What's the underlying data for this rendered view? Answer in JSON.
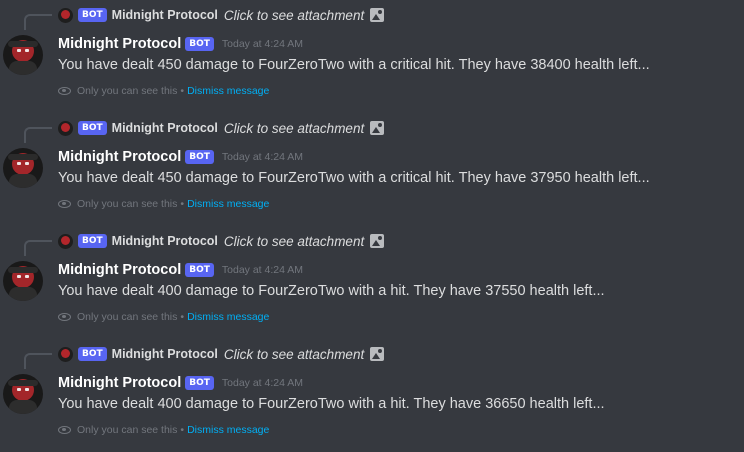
{
  "messages": [
    {
      "reply": {
        "bot_tag": "BOT",
        "name": "Midnight Protocol",
        "text": "Click to see attachment",
        "icon": "image-icon"
      },
      "author": "Midnight Protocol",
      "bot_tag": "BOT",
      "timestamp": "Today at 4:24 AM",
      "content": "You have dealt 450 damage to FourZeroTwo with a critical hit. They have 38400 health left...",
      "ephemeral_note": "Only you can see this",
      "separator": "•",
      "dismiss_label": "Dismiss message"
    },
    {
      "reply": {
        "bot_tag": "BOT",
        "name": "Midnight Protocol",
        "text": "Click to see attachment",
        "icon": "image-icon"
      },
      "author": "Midnight Protocol",
      "bot_tag": "BOT",
      "timestamp": "Today at 4:24 AM",
      "content": "You have dealt 450 damage to FourZeroTwo with a critical hit. They have 37950 health left...",
      "ephemeral_note": "Only you can see this",
      "separator": "•",
      "dismiss_label": "Dismiss message"
    },
    {
      "reply": {
        "bot_tag": "BOT",
        "name": "Midnight Protocol",
        "text": "Click to see attachment",
        "icon": "image-icon"
      },
      "author": "Midnight Protocol",
      "bot_tag": "BOT",
      "timestamp": "Today at 4:24 AM",
      "content": "You have dealt 400 damage to FourZeroTwo with a hit. They have 37550 health left...",
      "ephemeral_note": "Only you can see this",
      "separator": "•",
      "dismiss_label": "Dismiss message"
    },
    {
      "reply": {
        "bot_tag": "BOT",
        "name": "Midnight Protocol",
        "text": "Click to see attachment",
        "icon": "image-icon"
      },
      "author": "Midnight Protocol",
      "bot_tag": "BOT",
      "timestamp": "Today at 4:24 AM",
      "content": "You have dealt 400 damage to FourZeroTwo with a hit. They have 36650 health left...",
      "ephemeral_note": "Only you can see this",
      "separator": "•",
      "dismiss_label": "Dismiss message"
    }
  ],
  "colors": {
    "background": "#36393f",
    "bot_tag": "#5865f2",
    "link": "#00aff4",
    "muted": "#72767d",
    "text": "#dcddde"
  }
}
